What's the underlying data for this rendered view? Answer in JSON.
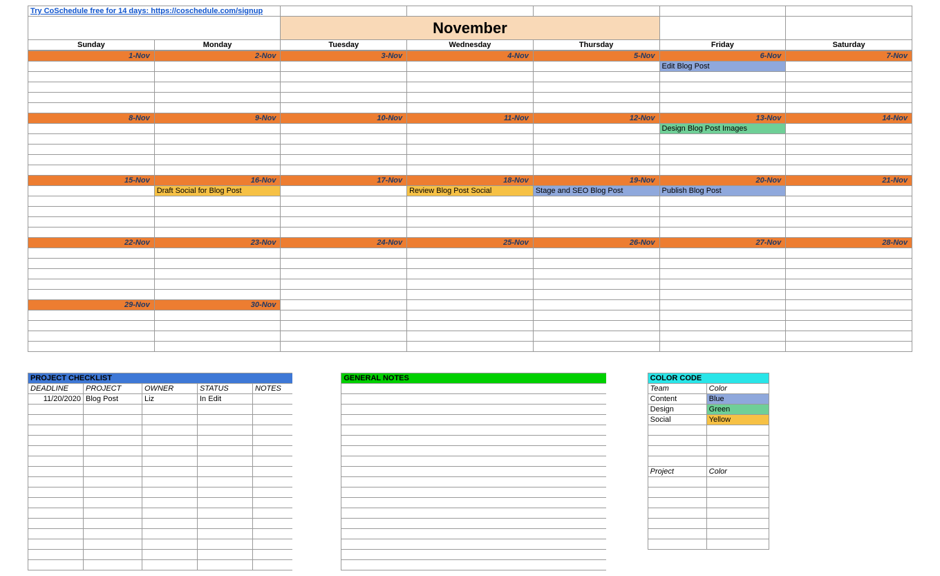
{
  "top_link": "Try CoSchedule free for 14 days: https://coschedule.com/signup",
  "month": "November",
  "days": [
    "Sunday",
    "Monday",
    "Tuesday",
    "Wednesday",
    "Thursday",
    "Friday",
    "Saturday"
  ],
  "weeks": [
    {
      "dates": [
        "1-Nov",
        "2-Nov",
        "3-Nov",
        "4-Nov",
        "5-Nov",
        "6-Nov",
        "7-Nov"
      ],
      "events": [
        {
          "row": 0,
          "col": 5,
          "text": "Edit Blog Post",
          "cls": "ev-blue"
        }
      ]
    },
    {
      "dates": [
        "8-Nov",
        "9-Nov",
        "10-Nov",
        "11-Nov",
        "12-Nov",
        "13-Nov",
        "14-Nov"
      ],
      "events": [
        {
          "row": 0,
          "col": 5,
          "text": "Design Blog Post Images",
          "cls": "ev-green"
        }
      ]
    },
    {
      "dates": [
        "15-Nov",
        "16-Nov",
        "17-Nov",
        "18-Nov",
        "19-Nov",
        "20-Nov",
        "21-Nov"
      ],
      "events": [
        {
          "row": 0,
          "col": 1,
          "text": "Draft Social for Blog Post",
          "cls": "ev-yellow"
        },
        {
          "row": 0,
          "col": 3,
          "text": "Review Blog Post Social",
          "cls": "ev-yellow"
        },
        {
          "row": 0,
          "col": 4,
          "text": "Stage and SEO Blog Post",
          "cls": "ev-blue"
        },
        {
          "row": 0,
          "col": 5,
          "text": "Publish Blog Post",
          "cls": "ev-blue"
        }
      ]
    },
    {
      "dates": [
        "22-Nov",
        "23-Nov",
        "24-Nov",
        "25-Nov",
        "26-Nov",
        "27-Nov",
        "28-Nov"
      ],
      "events": []
    },
    {
      "dates": [
        "29-Nov",
        "30-Nov",
        "",
        "",
        "",
        "",
        ""
      ],
      "events": []
    }
  ],
  "checklist": {
    "title": "PROJECT CHECKLIST",
    "cols": [
      "DEADLINE",
      "PROJECT",
      "OWNER",
      "STATUS",
      "NOTES"
    ],
    "rows": [
      {
        "deadline": "11/20/2020",
        "project": "Blog Post",
        "owner": "Liz",
        "status": "In Edit",
        "notes": ""
      }
    ]
  },
  "notes": {
    "title": "GENERAL NOTES"
  },
  "colorcode": {
    "title": "COLOR CODE",
    "team_label": "Team",
    "color_label": "Color",
    "rows": [
      {
        "team": "Content",
        "color": "Blue",
        "cls": "sw-blue"
      },
      {
        "team": "Design",
        "color": "Green",
        "cls": "sw-green"
      },
      {
        "team": "Social",
        "color": "Yellow",
        "cls": "sw-yellow"
      }
    ],
    "project_label": "Project"
  }
}
